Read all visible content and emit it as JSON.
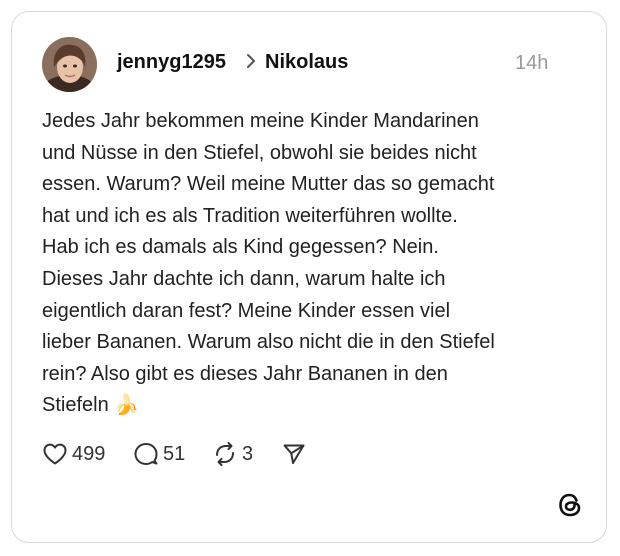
{
  "post": {
    "username": "jennyg1295",
    "topic": "Nikolaus",
    "time": "14h",
    "text": "Jedes Jahr bekommen meine Kinder Mandarinen\nund Nüsse in den Stiefel, obwohl sie beides nicht\nessen. Warum? Weil meine Mutter das so gemacht\nhat und ich es als Tradition weiterführen wollte.\nHab ich es damals als Kind gegessen? Nein.\nDieses Jahr dachte ich dann, warum halte ich\neigentlich daran fest? Meine Kinder essen viel\nlieber Bananen. Warum also nicht die in den Stiefel\nrein? Also gibt es dieses Jahr Bananen in den\nStiefeln 🍌"
  },
  "actions": {
    "likes": "499",
    "replies": "51",
    "reposts": "3"
  },
  "icons": {
    "like": "heart-icon",
    "reply": "speech-bubble-icon",
    "repost": "repost-icon",
    "share": "paper-plane-icon",
    "brand": "threads-logo-icon"
  }
}
